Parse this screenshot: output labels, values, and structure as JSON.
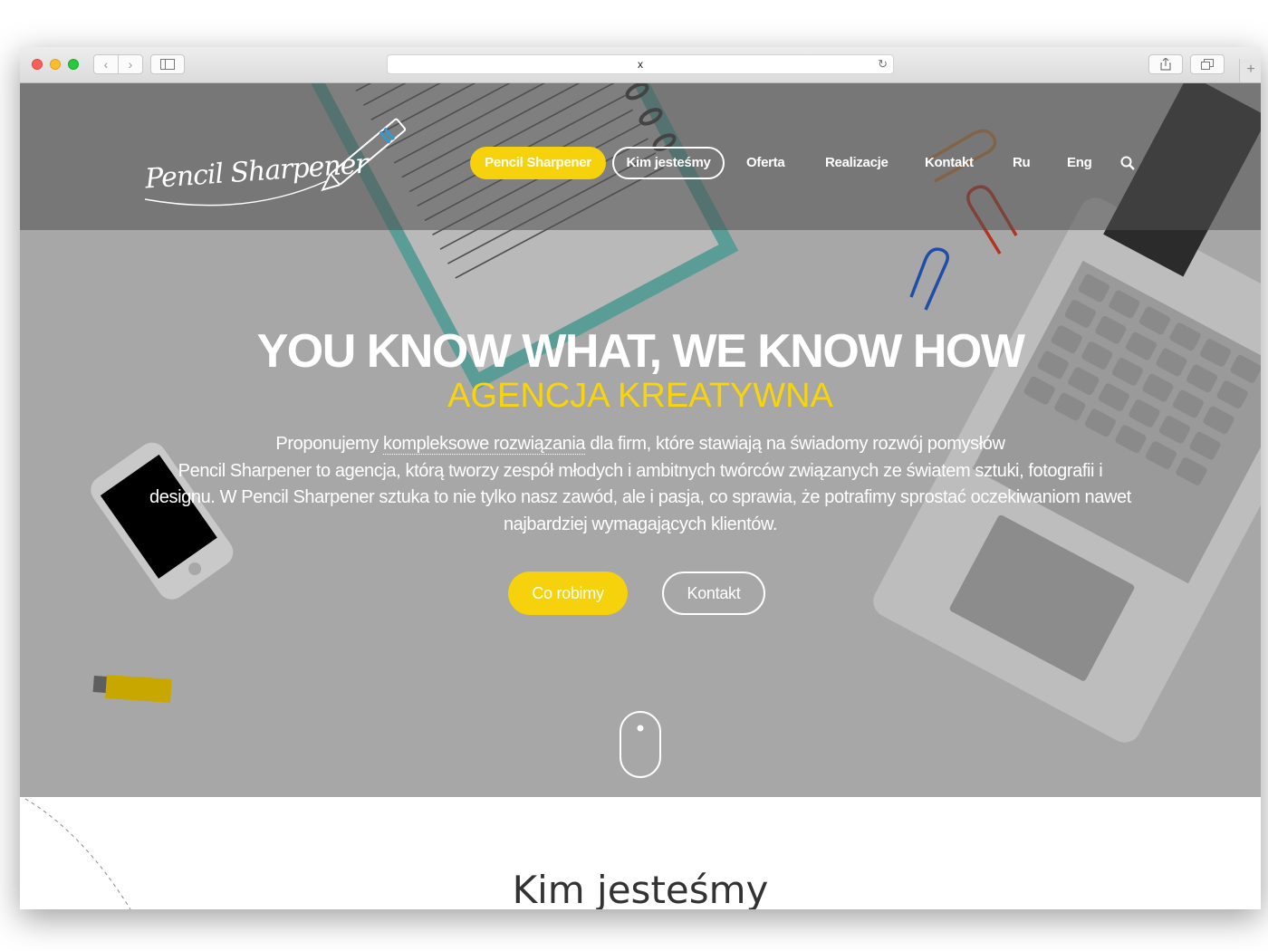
{
  "browser": {
    "url": "x",
    "back_glyph": "‹",
    "forward_glyph": "›",
    "reload_glyph": "↻",
    "newtab_glyph": "+"
  },
  "site": {
    "logo_text": "Pencil Sharpener",
    "nav": {
      "items": [
        "Pencil Sharpener",
        "Kim jesteśmy",
        "Oferta",
        "Realizacje",
        "Kontakt",
        "Ru",
        "Eng"
      ],
      "active_color": "#f5d20b"
    },
    "hero": {
      "headline": "YOU KNOW WHAT, WE KNOW HOW",
      "subheadline": "AGENCJA KREATYWNA",
      "para_line1_a": "Proponujemy ",
      "para_line1_link": "kompleksowe rozwiązania",
      "para_line1_b": " dla firm, które stawiają na świadomy rozwój pomysłów",
      "para_rest": "Pencil Sharpener to agencja, którą tworzy zespół młodych i ambitnych twórców związanych ze światem sztuki, fotografii i designu. W Pencil Sharpener sztuka to nie tylko nasz zawód, ale i pasja, co sprawia, że potrafimy sprostać oczekiwaniom nawet najbardziej wymagających klientów.",
      "primary_button": "Co robimy",
      "secondary_button": "Kontakt",
      "accent_color": "#f5d20b"
    },
    "section2": {
      "title": "Kim jesteśmy"
    }
  }
}
